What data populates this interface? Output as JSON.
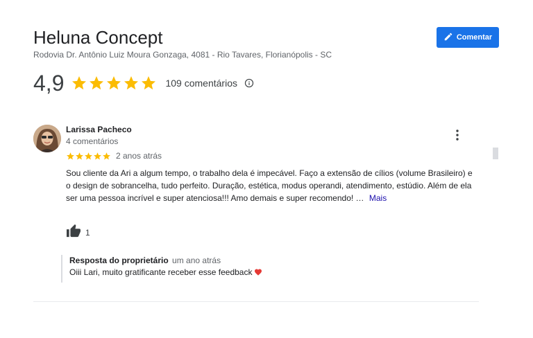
{
  "place": {
    "name": "Heluna Concept",
    "address": "Rodovia Dr. Antônio Luiz Moura Gonzaga, 4081 - Rio Tavares, Florianópolis - SC"
  },
  "actions": {
    "comment_label": "Comentar",
    "comment_icon": "pencil-icon"
  },
  "rating": {
    "value": "4,9",
    "stars": 5,
    "count_label": "109 comentários"
  },
  "review": {
    "author": "Larissa Pacheco",
    "author_meta": "4 comentários",
    "stars": 5,
    "date": "2 anos atrás",
    "text": "Sou cliente da Ari a algum tempo, o trabalho dela é impecável. Faço a extensão de cílios (volume Brasileiro) e o design de sobrancelha, tudo perfeito. Duração, estética, modus operandi, atendimento, estúdio. Além de ela ser uma pessoa incrível e super atenciosa!!! Amo demais e super recomendo! …",
    "more_label": "Mais",
    "likes": "1"
  },
  "owner_reply": {
    "label": "Resposta do proprietário",
    "date": "um ano atrás",
    "text": "Oiii Lari, muito gratificante receber esse feedback"
  },
  "colors": {
    "accent": "#1a73e8",
    "star": "#fbbc04",
    "heart": "#e53935"
  }
}
